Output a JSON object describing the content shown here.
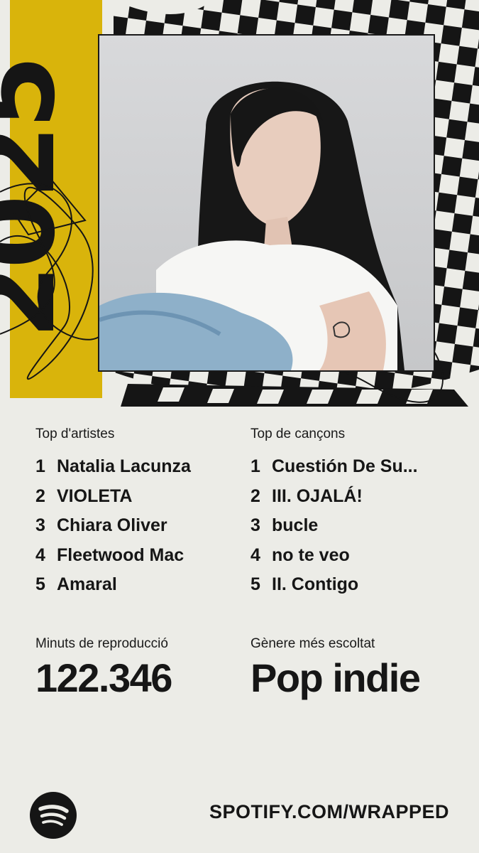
{
  "artwork": {
    "year_text": "2025",
    "colors": {
      "yellow": "#d9b40b",
      "black": "#151515",
      "cream": "#ecece7"
    }
  },
  "top_artists": {
    "title": "Top d'artistes",
    "items": [
      {
        "rank": "1",
        "name": "Natalia Lacunza"
      },
      {
        "rank": "2",
        "name": "VIOLETA"
      },
      {
        "rank": "3",
        "name": "Chiara Oliver"
      },
      {
        "rank": "4",
        "name": "Fleetwood Mac"
      },
      {
        "rank": "5",
        "name": "Amaral"
      }
    ]
  },
  "top_songs": {
    "title": "Top de cançons",
    "items": [
      {
        "rank": "1",
        "name": "Cuestión De Su..."
      },
      {
        "rank": "2",
        "name": "III. OJALÁ!"
      },
      {
        "rank": "3",
        "name": "bucle"
      },
      {
        "rank": "4",
        "name": "no te veo"
      },
      {
        "rank": "5",
        "name": "II. Contigo"
      }
    ]
  },
  "minutes": {
    "label": "Minuts de reproducció",
    "value": "122.346"
  },
  "genre": {
    "label": "Gènere més escoltat",
    "value": "Pop indie"
  },
  "footer": {
    "url": "SPOTIFY.COM/WRAPPED",
    "logo_icon": "spotify-logo-icon"
  }
}
